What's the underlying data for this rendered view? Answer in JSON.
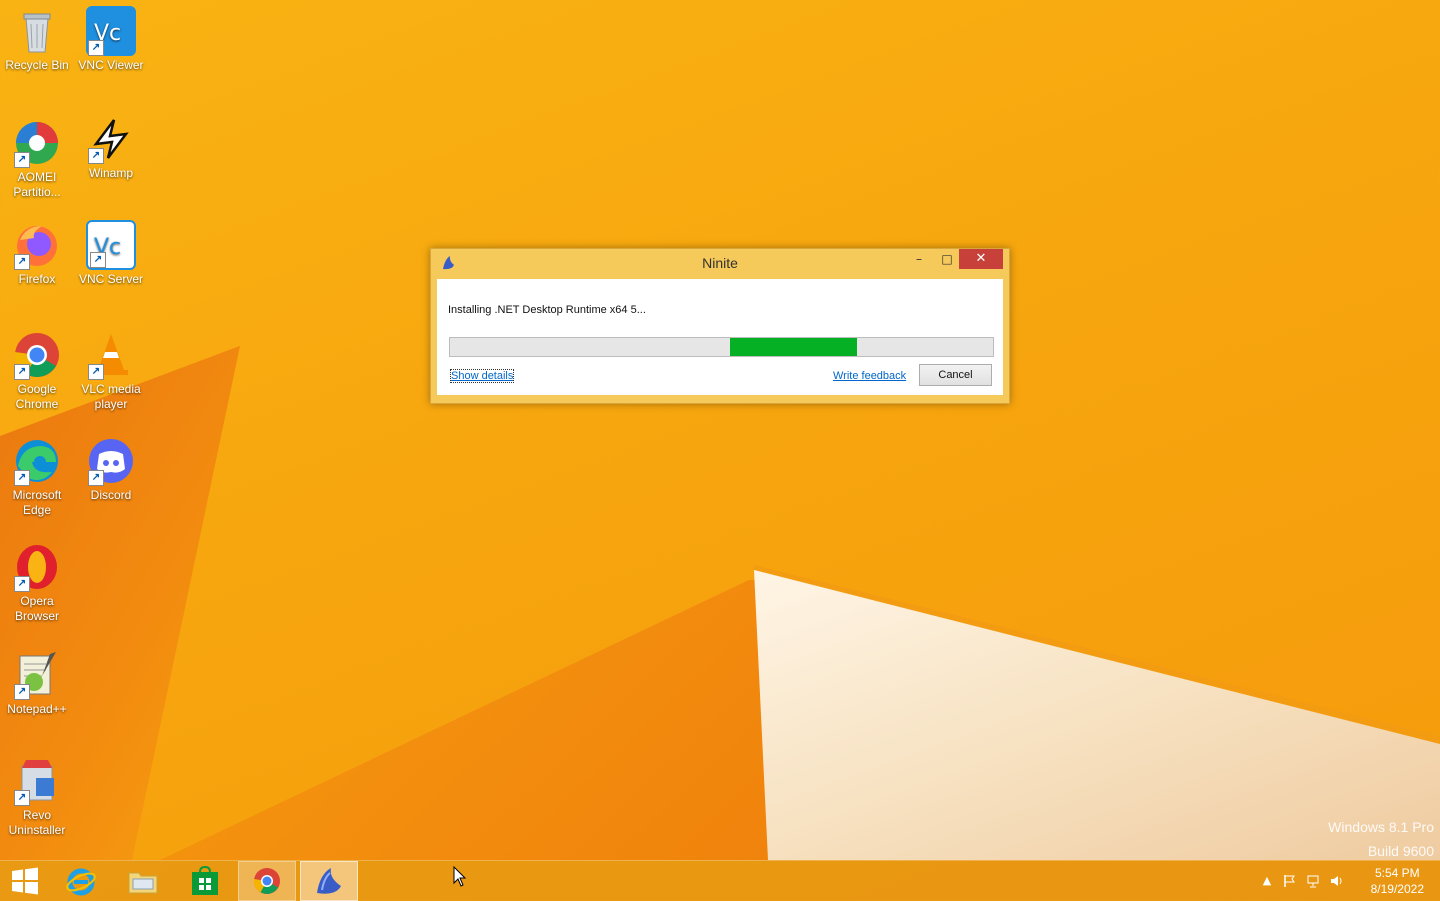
{
  "desktop": {
    "icons": [
      {
        "label": "Recycle Bin"
      },
      {
        "label": "VNC Viewer"
      },
      {
        "label": "AOMEI Partitio..."
      },
      {
        "label": "Winamp"
      },
      {
        "label": "Firefox"
      },
      {
        "label": "VNC Server"
      },
      {
        "label": "Google Chrome"
      },
      {
        "label": "VLC media player"
      },
      {
        "label": "Microsoft Edge"
      },
      {
        "label": "Discord"
      },
      {
        "label": "Opera Browser"
      },
      {
        "label": "Notepad++"
      },
      {
        "label": "Revo Uninstaller"
      }
    ]
  },
  "dialog": {
    "title": "Ninite",
    "status": "Installing .NET Desktop Runtime x64 5...",
    "progress": {
      "fill_start_fraction": 0.515,
      "fill_end_fraction": 0.75,
      "color": "#06b025"
    },
    "show_details": "Show details",
    "write_feedback": "Write feedback",
    "cancel": "Cancel",
    "minimize_glyph": "–",
    "maximize_glyph": "□",
    "close_glyph": "✕"
  },
  "watermark": {
    "line1": "Windows 8.1 Pro",
    "line2": "Build 9600"
  },
  "taskbar": {
    "items": [
      {
        "name": "start-button",
        "icon": "windows-logo-icon"
      },
      {
        "name": "internet-explorer",
        "icon": "internet-explorer-icon"
      },
      {
        "name": "file-explorer",
        "icon": "folder-icon"
      },
      {
        "name": "windows-store",
        "icon": "store-icon"
      },
      {
        "name": "google-chrome",
        "icon": "chrome-icon"
      },
      {
        "name": "ninite",
        "icon": "ninite-icon"
      }
    ],
    "tray": {
      "time": "5:54 PM",
      "date": "8/19/2022",
      "chevron": "▲"
    }
  },
  "colors": {
    "wallpaper": "#f7a60e",
    "close_button": "#c7413a",
    "link": "#0066cc"
  }
}
